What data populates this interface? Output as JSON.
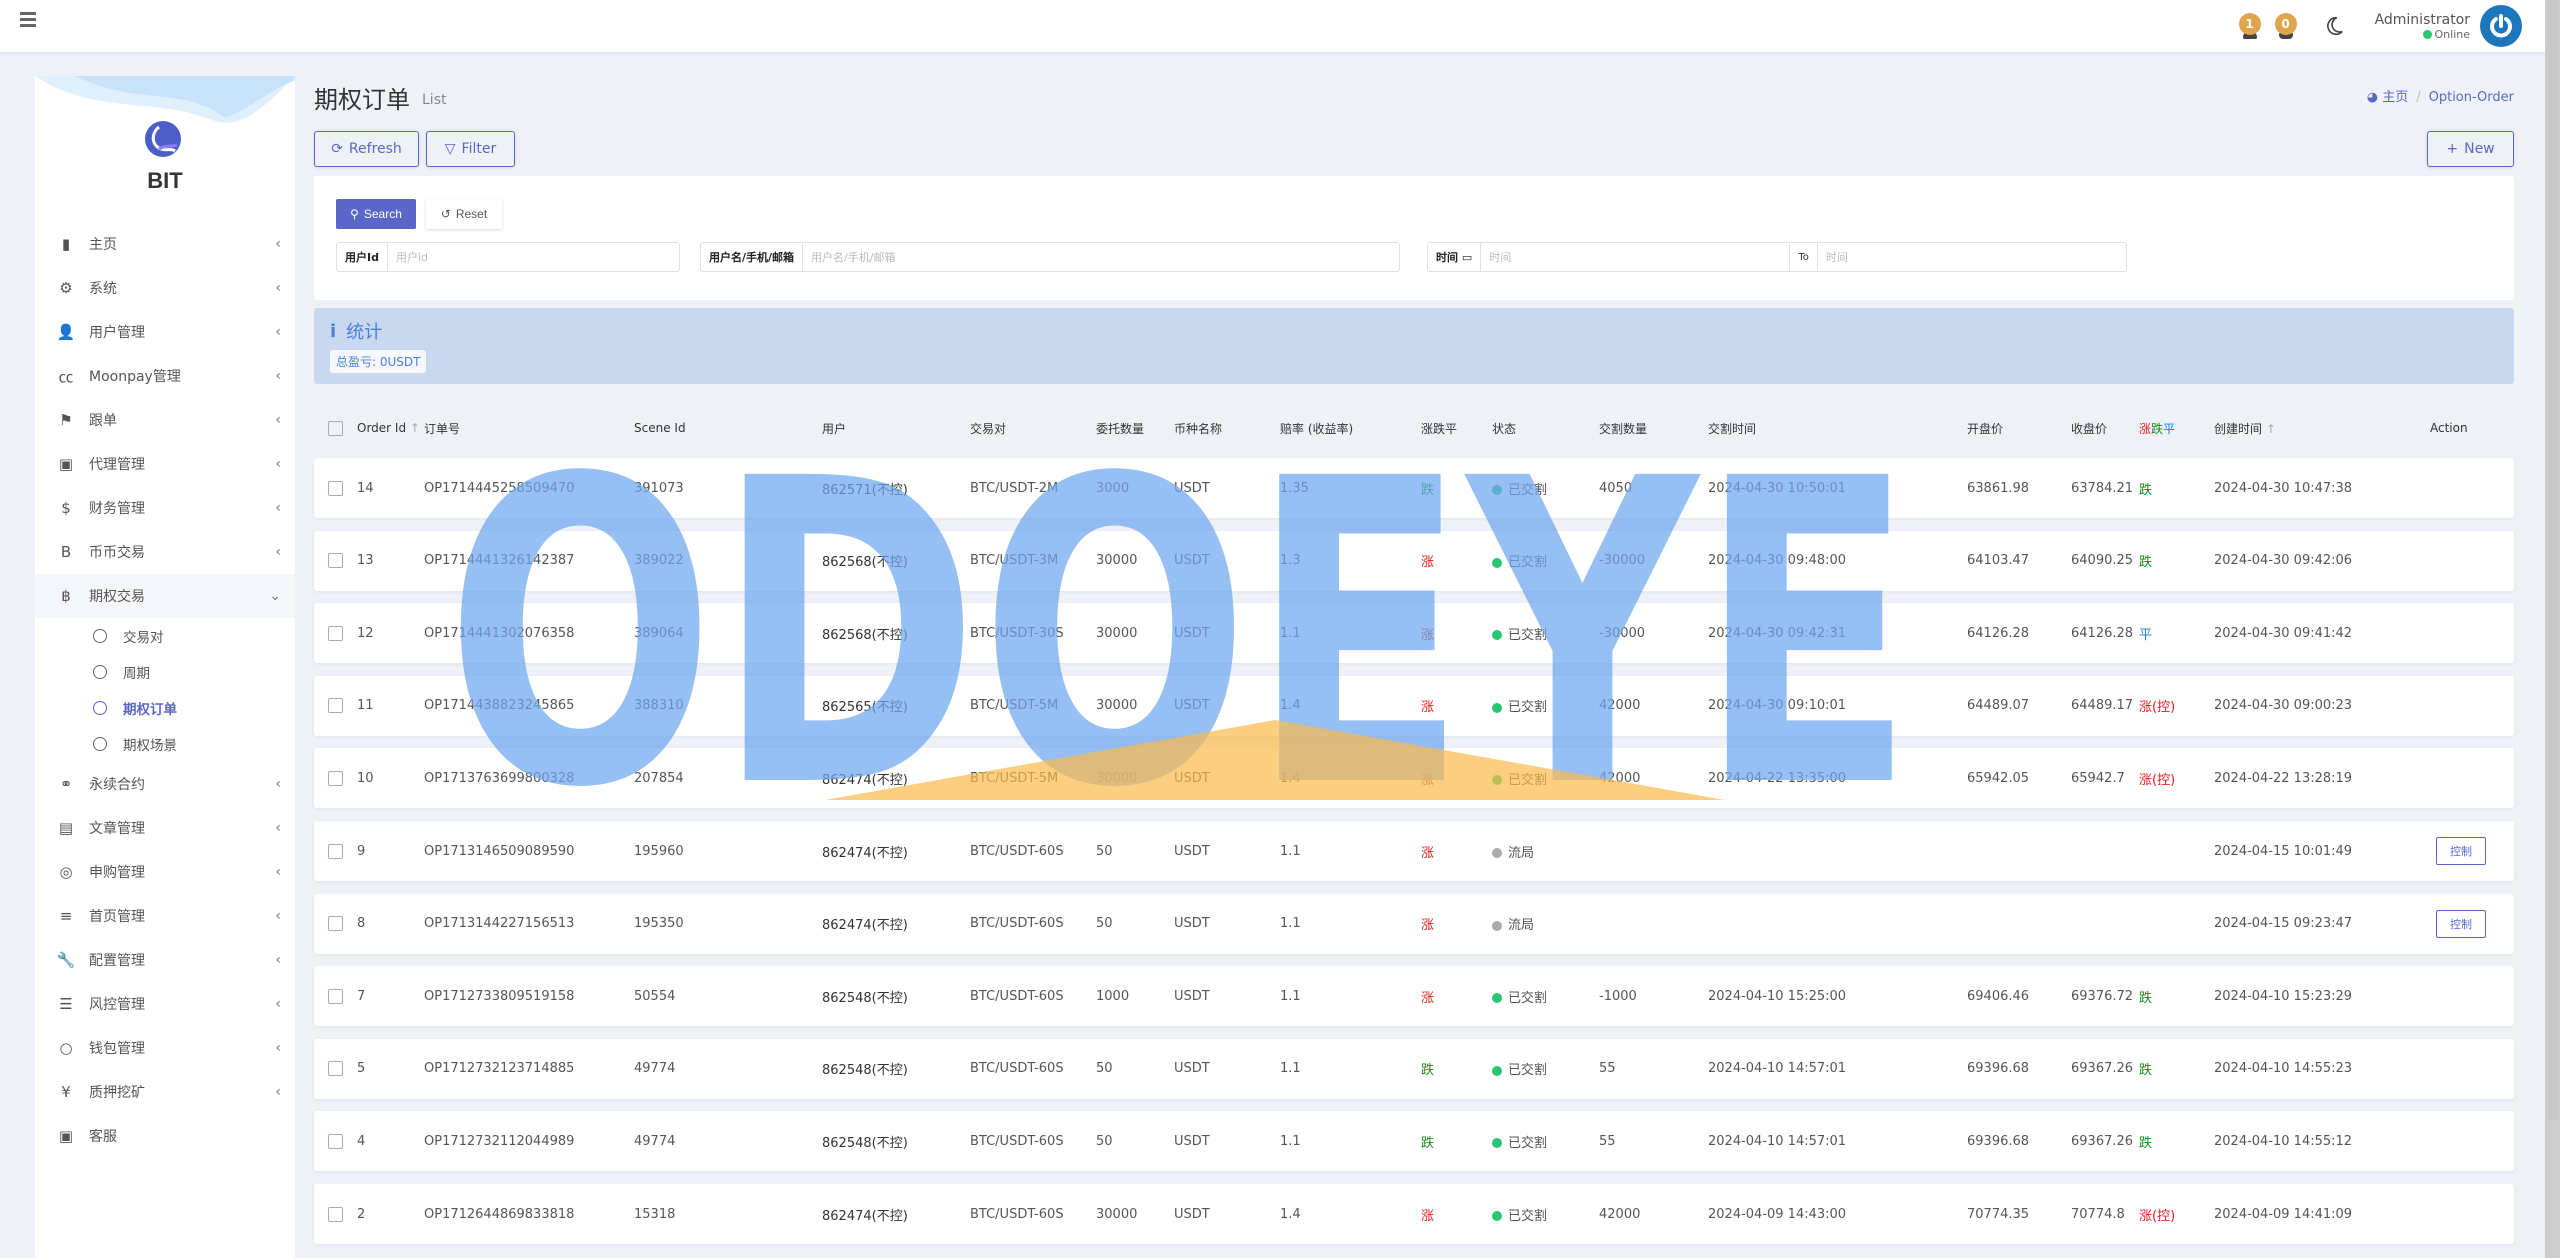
{
  "header": {
    "notifications": [
      {
        "name": "bell",
        "count": "1"
      },
      {
        "name": "message",
        "count": "0"
      }
    ],
    "user_name": "Administrator",
    "user_status": "Online"
  },
  "sidebar": {
    "brand": "BIT",
    "items": [
      {
        "label": "主页",
        "icon": "bar-chart-icon",
        "glyph": "▮",
        "has_children": true
      },
      {
        "label": "系统",
        "icon": "gear-icon",
        "glyph": "⚙",
        "has_children": true
      },
      {
        "label": "用户管理",
        "icon": "user-tie-icon",
        "glyph": "👤",
        "has_children": true
      },
      {
        "label": "Moonpay管理",
        "icon": "credit-card-icon",
        "glyph": "㏄",
        "has_children": true
      },
      {
        "label": "跟单",
        "icon": "flag-icon",
        "glyph": "⚑",
        "has_children": true
      },
      {
        "label": "代理管理",
        "icon": "id-card-icon",
        "glyph": "▣",
        "has_children": true
      },
      {
        "label": "财务管理",
        "icon": "dollar-icon",
        "glyph": "$",
        "has_children": true
      },
      {
        "label": "币币交易",
        "icon": "b-icon",
        "glyph": "B",
        "has_children": true
      },
      {
        "label": "期权交易",
        "icon": "bitcoin-icon",
        "glyph": "฿",
        "has_children": true,
        "expanded": true,
        "children": [
          {
            "label": "交易对",
            "current": false
          },
          {
            "label": "周期",
            "current": false
          },
          {
            "label": "期权订单",
            "current": true
          },
          {
            "label": "期权场景",
            "current": false
          }
        ]
      },
      {
        "label": "永续合约",
        "icon": "link-icon",
        "glyph": "⚭",
        "has_children": true
      },
      {
        "label": "文章管理",
        "icon": "newspaper-icon",
        "glyph": "▤",
        "has_children": true
      },
      {
        "label": "申购管理",
        "icon": "life-ring-icon",
        "glyph": "◎",
        "has_children": true
      },
      {
        "label": "首页管理",
        "icon": "bars-icon",
        "glyph": "≡",
        "has_children": true
      },
      {
        "label": "配置管理",
        "icon": "wrench-icon",
        "glyph": "🔧",
        "has_children": true
      },
      {
        "label": "风控管理",
        "icon": "outdent-icon",
        "glyph": "☰",
        "has_children": true
      },
      {
        "label": "钱包管理",
        "icon": "circle-icon",
        "glyph": "○",
        "has_children": true
      },
      {
        "label": "质押挖矿",
        "icon": "yen-icon",
        "glyph": "¥",
        "has_children": true
      },
      {
        "label": "客服",
        "icon": "contact-card-icon",
        "glyph": "▣",
        "has_children": false
      }
    ]
  },
  "page": {
    "title": "期权订单",
    "subtitle": "List",
    "breadcrumb": [
      {
        "label": "主页"
      },
      {
        "label": "Option-Order"
      }
    ],
    "buttons": {
      "refresh": "Refresh",
      "filter": "Filter",
      "new": "New"
    }
  },
  "filter": {
    "search_label": "Search",
    "reset_label": "Reset",
    "fields": {
      "user_id": {
        "label": "用户Id",
        "placeholder": "用户id",
        "value": ""
      },
      "username": {
        "label": "用户名/手机/邮箱",
        "placeholder": "用户名/手机/邮箱",
        "value": ""
      },
      "time": {
        "label": "时间",
        "placeholder_from": "时间",
        "to_label": "To",
        "placeholder_to": "时间",
        "value_from": "",
        "value_to": ""
      }
    }
  },
  "stats": {
    "title": "统计",
    "total_pnl": "总盈亏: 0USDT"
  },
  "table": {
    "columns": [
      "Order Id",
      "订单号",
      "Scene Id",
      "用户",
      "交易对",
      "委托数量",
      "币种名称",
      "赔率 (收益率)",
      "涨跌平",
      "状态",
      "交割数量",
      "交割时间",
      "开盘价",
      "收盘价",
      "涨跌平",
      "创建时间",
      "Action"
    ],
    "result_legend": [
      {
        "text": "涨",
        "color": "#e02020"
      },
      {
        "text": "跌",
        "color": "#1a8a1a"
      },
      {
        "text": "平",
        "color": "#1e7be0"
      }
    ],
    "rows": [
      {
        "order_id": "14",
        "order_no": "OP1714445258509470",
        "scene_id": "391073",
        "user": "862571(不控)",
        "pair": "BTC/USDT-2M",
        "qty": "3000",
        "coin": "USDT",
        "odds": "1.35",
        "direction": "跌",
        "direction_color": "#1a8a1a",
        "status": "已交割",
        "status_color": "#28c76f",
        "settle_qty": "4050",
        "settle_time": "2024-04-30 10:50:01",
        "open": "63861.98",
        "close": "63784.21",
        "result": "跌",
        "result_color": "#1a8a1a",
        "created": "2024-04-30 10:47:38",
        "action": ""
      },
      {
        "order_id": "13",
        "order_no": "OP1714441326142387",
        "scene_id": "389022",
        "user": "862568(不控)",
        "pair": "BTC/USDT-3M",
        "qty": "30000",
        "coin": "USDT",
        "odds": "1.3",
        "direction": "涨",
        "direction_color": "#e02020",
        "status": "已交割",
        "status_color": "#28c76f",
        "settle_qty": "-30000",
        "settle_time": "2024-04-30 09:48:00",
        "open": "64103.47",
        "close": "64090.25",
        "result": "跌",
        "result_color": "#1a8a1a",
        "created": "2024-04-30 09:42:06",
        "action": ""
      },
      {
        "order_id": "12",
        "order_no": "OP1714441302076358",
        "scene_id": "389064",
        "user": "862568(不控)",
        "pair": "BTC/USDT-30S",
        "qty": "30000",
        "coin": "USDT",
        "odds": "1.1",
        "direction": "涨",
        "direction_color": "#e02020",
        "status": "已交割",
        "status_color": "#28c76f",
        "settle_qty": "-30000",
        "settle_time": "2024-04-30 09:42:31",
        "open": "64126.28",
        "close": "64126.28",
        "result": "平",
        "result_color": "#1e7be0",
        "created": "2024-04-30 09:41:42",
        "action": ""
      },
      {
        "order_id": "11",
        "order_no": "OP1714438823245865",
        "scene_id": "388310",
        "user": "862565(不控)",
        "pair": "BTC/USDT-5M",
        "qty": "30000",
        "coin": "USDT",
        "odds": "1.4",
        "direction": "涨",
        "direction_color": "#e02020",
        "status": "已交割",
        "status_color": "#28c76f",
        "settle_qty": "42000",
        "settle_time": "2024-04-30 09:10:01",
        "open": "64489.07",
        "close": "64489.17",
        "result": "涨(控)",
        "result_color": "#e02020",
        "created": "2024-04-30 09:00:23",
        "action": ""
      },
      {
        "order_id": "10",
        "order_no": "OP1713763699800328",
        "scene_id": "207854",
        "user": "862474(不控)",
        "pair": "BTC/USDT-5M",
        "qty": "30000",
        "coin": "USDT",
        "odds": "1.4",
        "direction": "涨",
        "direction_color": "#e02020",
        "status": "已交割",
        "status_color": "#28c76f",
        "settle_qty": "42000",
        "settle_time": "2024-04-22 13:35:00",
        "open": "65942.05",
        "close": "65942.7",
        "result": "涨(控)",
        "result_color": "#e02020",
        "created": "2024-04-22 13:28:19",
        "action": ""
      },
      {
        "order_id": "9",
        "order_no": "OP1713146509089590",
        "scene_id": "195960",
        "user": "862474(不控)",
        "pair": "BTC/USDT-60S",
        "qty": "50",
        "coin": "USDT",
        "odds": "1.1",
        "direction": "涨",
        "direction_color": "#e02020",
        "status": "流局",
        "status_color": "#aaaaaa",
        "settle_qty": "",
        "settle_time": "",
        "open": "",
        "close": "",
        "result": "",
        "result_color": "#333333",
        "created": "2024-04-15 10:01:49",
        "action": "控制"
      },
      {
        "order_id": "8",
        "order_no": "OP1713144227156513",
        "scene_id": "195350",
        "user": "862474(不控)",
        "pair": "BTC/USDT-60S",
        "qty": "50",
        "coin": "USDT",
        "odds": "1.1",
        "direction": "涨",
        "direction_color": "#e02020",
        "status": "流局",
        "status_color": "#aaaaaa",
        "settle_qty": "",
        "settle_time": "",
        "open": "",
        "close": "",
        "result": "",
        "result_color": "#333333",
        "created": "2024-04-15 09:23:47",
        "action": "控制"
      },
      {
        "order_id": "7",
        "order_no": "OP1712733809519158",
        "scene_id": "50554",
        "user": "862548(不控)",
        "pair": "BTC/USDT-60S",
        "qty": "1000",
        "coin": "USDT",
        "odds": "1.1",
        "direction": "涨",
        "direction_color": "#e02020",
        "status": "已交割",
        "status_color": "#28c76f",
        "settle_qty": "-1000",
        "settle_time": "2024-04-10 15:25:00",
        "open": "69406.46",
        "close": "69376.72",
        "result": "跌",
        "result_color": "#1a8a1a",
        "created": "2024-04-10 15:23:29",
        "action": ""
      },
      {
        "order_id": "5",
        "order_no": "OP1712732123714885",
        "scene_id": "49774",
        "user": "862548(不控)",
        "pair": "BTC/USDT-60S",
        "qty": "50",
        "coin": "USDT",
        "odds": "1.1",
        "direction": "跌",
        "direction_color": "#1a8a1a",
        "status": "已交割",
        "status_color": "#28c76f",
        "settle_qty": "55",
        "settle_time": "2024-04-10 14:57:01",
        "open": "69396.68",
        "close": "69367.26",
        "result": "跌",
        "result_color": "#1a8a1a",
        "created": "2024-04-10 14:55:23",
        "action": ""
      },
      {
        "order_id": "4",
        "order_no": "OP1712732112044989",
        "scene_id": "49774",
        "user": "862548(不控)",
        "pair": "BTC/USDT-60S",
        "qty": "50",
        "coin": "USDT",
        "odds": "1.1",
        "direction": "跌",
        "direction_color": "#1a8a1a",
        "status": "已交割",
        "status_color": "#28c76f",
        "settle_qty": "55",
        "settle_time": "2024-04-10 14:57:01",
        "open": "69396.68",
        "close": "69367.26",
        "result": "跌",
        "result_color": "#1a8a1a",
        "created": "2024-04-10 14:55:12",
        "action": ""
      },
      {
        "order_id": "2",
        "order_no": "OP1712644869833818",
        "scene_id": "15318",
        "user": "862474(不控)",
        "pair": "BTC/USDT-60S",
        "qty": "30000",
        "coin": "USDT",
        "odds": "1.4",
        "direction": "涨",
        "direction_color": "#e02020",
        "status": "已交割",
        "status_color": "#28c76f",
        "settle_qty": "42000",
        "settle_time": "2024-04-09 14:43:00",
        "open": "70774.35",
        "close": "70774.8",
        "result": "涨(控)",
        "result_color": "#e02020",
        "created": "2024-04-09 14:41:09",
        "action": ""
      }
    ]
  },
  "watermark": {
    "text": "ODOEYE"
  },
  "colors": {
    "accent": "#5a67c9",
    "stats_bg": "#c8d8ee",
    "up": "#e02020",
    "down": "#1a8a1a",
    "flat": "#1e7be0"
  }
}
